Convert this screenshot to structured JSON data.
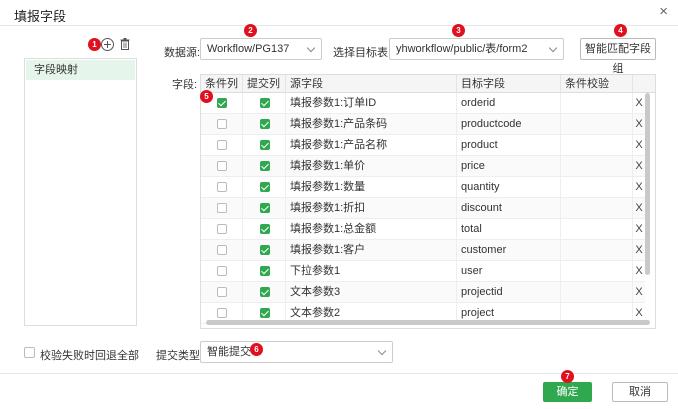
{
  "dialog": {
    "title": "填报字段",
    "close": "×"
  },
  "badges": {
    "b1": "1",
    "b2": "2",
    "b3": "3",
    "b4": "4",
    "b5": "5",
    "b6": "6",
    "b7": "7"
  },
  "left_panel": {
    "items": [
      {
        "label": "字段映射"
      }
    ]
  },
  "datasource": {
    "label": "数据源:",
    "value": "Workflow/PG137"
  },
  "target_table": {
    "label": "选择目标表:",
    "value": "yhworkflow/public/表/form2"
  },
  "smart_button": "智能匹配字段组",
  "fields_label": "字段:",
  "table": {
    "headers": [
      "条件列",
      "提交列",
      "源字段",
      "目标字段",
      "条件校验"
    ],
    "rows": [
      {
        "cond": true,
        "submit": true,
        "source": "填报参数1:订单ID",
        "target": "orderid",
        "check": "",
        "del": "X"
      },
      {
        "cond": false,
        "submit": true,
        "source": "填报参数1:产品条码",
        "target": "productcode",
        "check": "",
        "del": "X"
      },
      {
        "cond": false,
        "submit": true,
        "source": "填报参数1:产品名称",
        "target": "product",
        "check": "",
        "del": "X"
      },
      {
        "cond": false,
        "submit": true,
        "source": "填报参数1:单价",
        "target": "price",
        "check": "",
        "del": "X"
      },
      {
        "cond": false,
        "submit": true,
        "source": "填报参数1:数量",
        "target": "quantity",
        "check": "",
        "del": "X"
      },
      {
        "cond": false,
        "submit": true,
        "source": "填报参数1:折扣",
        "target": "discount",
        "check": "",
        "del": "X"
      },
      {
        "cond": false,
        "submit": true,
        "source": "填报参数1:总金额",
        "target": "total",
        "check": "",
        "del": "X"
      },
      {
        "cond": false,
        "submit": true,
        "source": "填报参数1:客户",
        "target": "customer",
        "check": "",
        "del": "X"
      },
      {
        "cond": false,
        "submit": true,
        "source": "下拉参数1",
        "target": "user",
        "check": "",
        "del": "X"
      },
      {
        "cond": false,
        "submit": true,
        "source": "文本参数3",
        "target": "projectid",
        "check": "",
        "del": "X"
      },
      {
        "cond": false,
        "submit": true,
        "source": "文本参数2",
        "target": "project",
        "check": "",
        "del": "X"
      }
    ]
  },
  "rollback": {
    "label": "校验失败时回退全部",
    "checked": false
  },
  "submit_type": {
    "label": "提交类型:",
    "value": "智能提交"
  },
  "footer": {
    "ok": "确定",
    "cancel": "取消"
  },
  "colors": {
    "accent": "#2fa84f",
    "badge": "#e0101e",
    "selected_row": "#e6f5ec"
  }
}
